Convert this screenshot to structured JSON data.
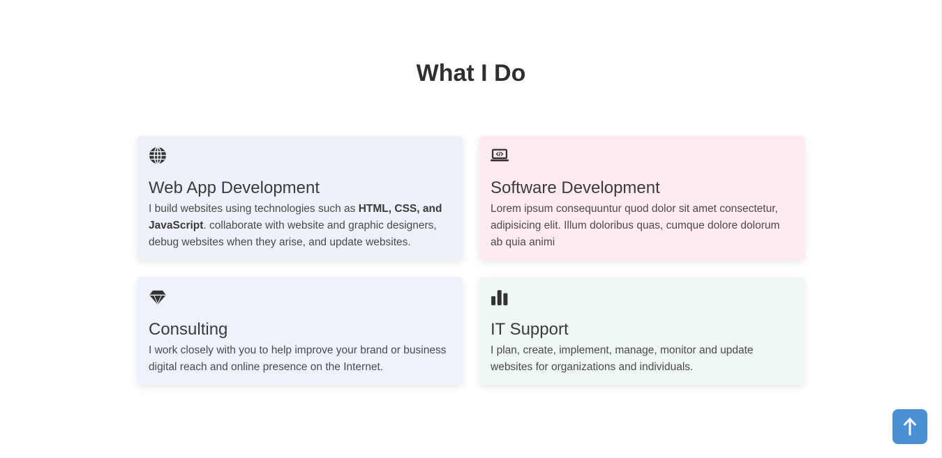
{
  "section": {
    "title": "What I Do"
  },
  "services": [
    {
      "id": "web",
      "icon": "globe-icon",
      "title": "Web App Development",
      "text_before": "I build websites using technologies such as ",
      "text_bold": "HTML, CSS, and JavaScript",
      "text_after": ". collaborate with website and graphic designers, debug websites when they arise, and update websites.",
      "background": "#eef1f9"
    },
    {
      "id": "software",
      "icon": "laptop-code-icon",
      "title": "Software Development",
      "text": "Lorem ipsum consequuntur quod dolor sit amet consectetur, adipisicing elit. Illum doloribus quas, cumque dolore dolorum ab quia animi",
      "background": "#ffebef"
    },
    {
      "id": "consulting",
      "icon": "gem-icon",
      "title": "Consulting",
      "text": "I work closely with you to help improve your brand or business digital reach and online presence on the Internet.",
      "background": "#eef3fb"
    },
    {
      "id": "it",
      "icon": "bar-chart-icon",
      "title": "IT Support",
      "text": "I plan, create, implement, manage, monitor and update websites for organizations and individuals.",
      "background": "#eff7f3"
    }
  ],
  "scroll_top": {
    "icon": "arrow-up-icon",
    "background": "#4a90d4",
    "icon_color": "#ffffff"
  }
}
